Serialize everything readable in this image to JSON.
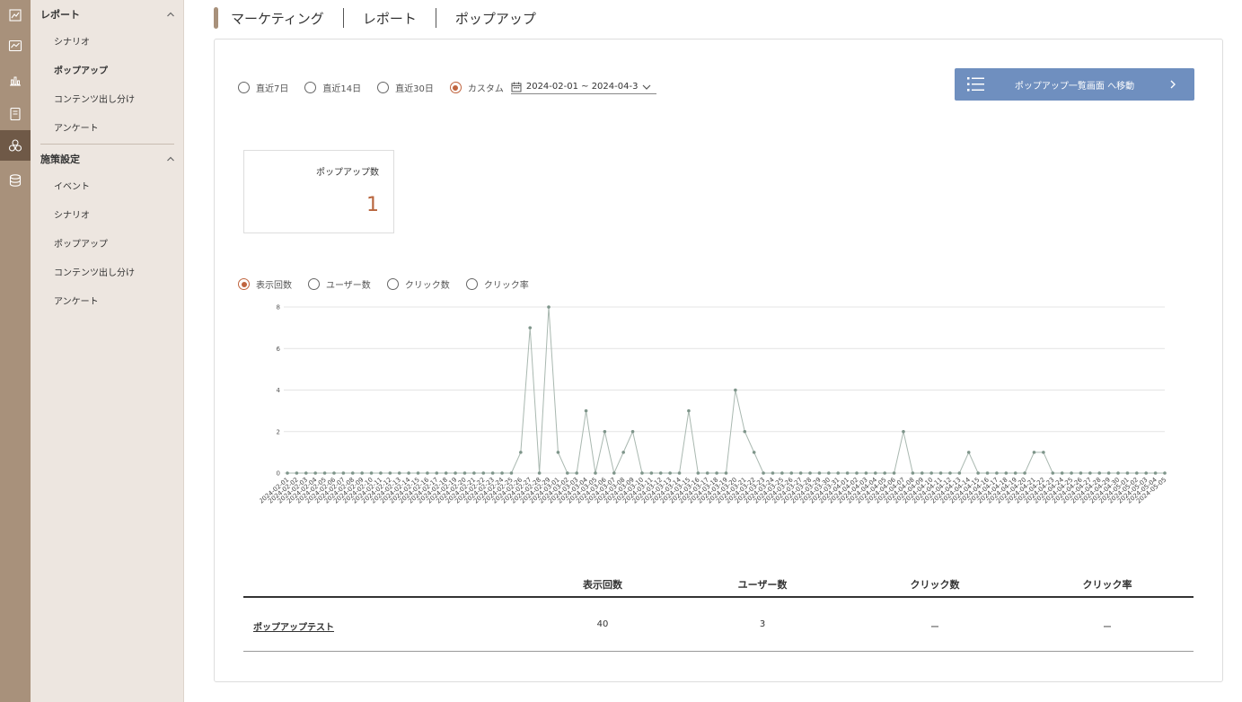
{
  "rail": {
    "icons": [
      "chart-board-icon",
      "line-chart-icon",
      "bar-chart-icon",
      "document-icon",
      "shapes-icon",
      "database-icon"
    ],
    "active_index": 4
  },
  "sidebar": {
    "sections": [
      {
        "title": "レポート",
        "items": [
          {
            "label": "シナリオ",
            "active": false
          },
          {
            "label": "ポップアップ",
            "active": true
          },
          {
            "label": "コンテンツ出し分け",
            "active": false
          },
          {
            "label": "アンケート",
            "active": false
          }
        ]
      },
      {
        "title": "施策設定",
        "items": [
          {
            "label": "イベント",
            "active": false
          },
          {
            "label": "シナリオ",
            "active": false
          },
          {
            "label": "ポップアップ",
            "active": false
          },
          {
            "label": "コンテンツ出し分け",
            "active": false
          },
          {
            "label": "アンケート",
            "active": false
          }
        ]
      }
    ]
  },
  "header": {
    "breadcrumbs": [
      "マーケティング",
      "レポート",
      "ポップアップ"
    ]
  },
  "period": {
    "options": [
      "直近7日",
      "直近14日",
      "直近30日",
      "カスタム"
    ],
    "selected": "カスタム",
    "range_value": "2024-02-01 ~ 2024-04-3"
  },
  "go_button": {
    "label": "ポップアップ一覧画面 へ移動"
  },
  "stat": {
    "title": "ポップアップ数",
    "value": "1"
  },
  "metrics": {
    "options": [
      "表示回数",
      "ユーザー数",
      "クリック数",
      "クリック率"
    ],
    "selected": "表示回数"
  },
  "colors": {
    "accent": "#c0653f",
    "button": "#6f8fbf",
    "rail": "#a8917b",
    "rail_active": "#6f5947",
    "sidebar": "#ede6e0",
    "line": "#a9b8b0",
    "point": "#7e958a"
  },
  "chart_data": {
    "type": "line",
    "x_start": "2024-02-01",
    "x_end": "2024-04-30",
    "y_ticks": [
      0,
      2,
      4,
      6,
      8
    ],
    "ylim": [
      0,
      8
    ],
    "grid": true,
    "series": [
      {
        "values": [
          0,
          0,
          0,
          0,
          0,
          0,
          0,
          0,
          0,
          0,
          0,
          0,
          0,
          0,
          0,
          0,
          0,
          0,
          0,
          0,
          0,
          0,
          0,
          0,
          0,
          1,
          7,
          0,
          8,
          1,
          0,
          0,
          3,
          0,
          2,
          0,
          1,
          2,
          0,
          0,
          0,
          0,
          0,
          3,
          0,
          0,
          0,
          0,
          4,
          2,
          1,
          0,
          0,
          0,
          0,
          0,
          0,
          0,
          0,
          0,
          0,
          0,
          0,
          0,
          0,
          0,
          2,
          0,
          0,
          0,
          0,
          0,
          0,
          1,
          0,
          0,
          0,
          0,
          0,
          0,
          1,
          1,
          0,
          0,
          0,
          0,
          0,
          0,
          0,
          0,
          0,
          0,
          0,
          0,
          0
        ]
      }
    ]
  },
  "table": {
    "headers": [
      "表示回数",
      "ユーザー数",
      "クリック数",
      "クリック率"
    ],
    "rows": [
      {
        "name": "ポップアップテスト",
        "impressions": "40",
        "users": "3",
        "clicks": "ー",
        "ctr": "ー"
      }
    ]
  }
}
